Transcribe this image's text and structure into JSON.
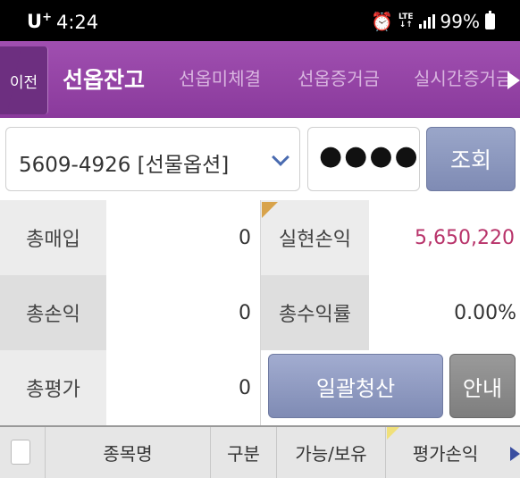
{
  "status_bar": {
    "carrier": "U",
    "carrier_sup": "+",
    "time": "4:24",
    "network": "LTE",
    "battery": "99%",
    "icons": [
      "alarm-icon",
      "lte-icon",
      "signal-icon",
      "battery-icon"
    ]
  },
  "header": {
    "back_label": "이전",
    "tabs": [
      {
        "label": "선옵잔고",
        "active": true
      },
      {
        "label": "선옵미체결",
        "active": false
      },
      {
        "label": "선옵증거금",
        "active": false
      },
      {
        "label": "실시간증거금",
        "active": false
      }
    ]
  },
  "account": {
    "selected": "5609-4926 [선물옵션]",
    "password_mask": "●●●●",
    "query_label": "조회"
  },
  "summary": {
    "total_buy_label": "총매입",
    "total_buy_value": "0",
    "realized_pl_label": "실현손익",
    "realized_pl_value": "5,650,220",
    "total_pl_label": "총손익",
    "total_pl_value": "0",
    "total_return_label": "총수익률",
    "total_return_value": "0.00%",
    "total_eval_label": "총평가",
    "total_eval_value": "0",
    "settle_all_label": "일괄청산",
    "guide_label": "안내"
  },
  "table": {
    "columns": [
      "종목명",
      "구분",
      "가능/보유",
      "평가손익"
    ]
  },
  "colors": {
    "header_purple": "#9a48ab",
    "positive_value": "#b8336a",
    "button_blue": "#8a96bf"
  }
}
